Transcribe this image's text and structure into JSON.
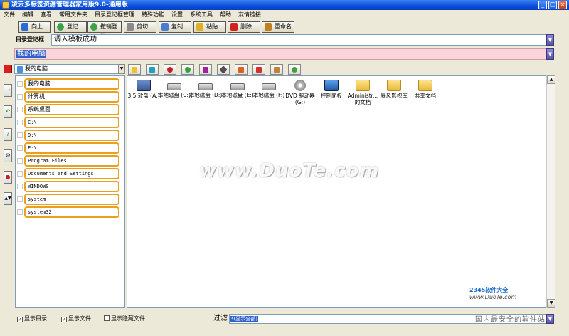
{
  "window": {
    "title": "凌云多标签资源管理器家用版9.0-通用版",
    "buttons": [
      "_",
      "□",
      "×"
    ]
  },
  "menu": [
    "文件",
    "编辑",
    "查看",
    "常用文件夹",
    "目录登记框管理",
    "特殊功能",
    "设置",
    "系统工具",
    "帮助",
    "友情链接"
  ],
  "toolbar": [
    {
      "label": "向上",
      "icon": "up-arrow-icon",
      "color": "#2a6bd1"
    },
    {
      "label": "登记",
      "icon": "register-icon",
      "color": "#3aa34a"
    },
    {
      "label": "撤销登记",
      "icon": "unregister-icon",
      "color": "#3aa34a"
    },
    {
      "label": "剪切",
      "icon": "scissors-icon",
      "color": "#8a8a8a"
    },
    {
      "label": "复制",
      "icon": "copy-icon",
      "color": "#4a7bd1"
    },
    {
      "label": "粘贴",
      "icon": "paste-icon",
      "color": "#e0b020"
    },
    {
      "label": "删除",
      "icon": "delete-icon",
      "color": "#d02020"
    },
    {
      "label": "重命名",
      "icon": "rename-icon",
      "color": "#c08020"
    }
  ],
  "register": {
    "label": "目录登记框",
    "message": "调入模板成功"
  },
  "path": {
    "value": "我的电脑"
  },
  "tree_combo": {
    "value": "我的电脑"
  },
  "tree": [
    "我的电脑",
    "计算机",
    "系统桌面",
    "C:\\",
    "D:\\",
    "E:\\",
    "Program Files",
    "Documents and Settings",
    "WINDOWS",
    "system",
    "system32"
  ],
  "file_toolbar_colors": [
    "#f0c030",
    "#20a0c0",
    "#c02020",
    "#30a040",
    "#a020a0",
    "#505050",
    "#e06020",
    "#d03030",
    "#c08040",
    "#40a040"
  ],
  "files": [
    {
      "label": "3.5 软盘 (A:)",
      "kind": "floppy"
    },
    {
      "label": "本地磁盘 (C:)",
      "kind": "drive"
    },
    {
      "label": "本地磁盘 (D:)",
      "kind": "drive"
    },
    {
      "label": "本地磁盘 (E:)",
      "kind": "drive"
    },
    {
      "label": "本地磁盘 (F:)",
      "kind": "drive"
    },
    {
      "label": "DVD 驱动器 (G:)",
      "kind": "dvd"
    },
    {
      "label": "控制面板",
      "kind": "ctrl"
    },
    {
      "label": "Administr... 的文档",
      "kind": "folder"
    },
    {
      "label": "暴风影视库",
      "kind": "folder"
    },
    {
      "label": "共享文档",
      "kind": "folder"
    }
  ],
  "bottom": {
    "show_dirs": {
      "label": "显示目录",
      "checked": true
    },
    "show_files": {
      "label": "显示文件",
      "checked": true
    },
    "show_hidden": {
      "label": "显示隐藏文件",
      "checked": false
    },
    "filter_label": "过滤",
    "filter_value": "*(显示全部)"
  },
  "watermark": "www.DuoTe.com",
  "brand": {
    "logo": "2345软件大全",
    "url": "www.DuoTe.com",
    "tagline": "国内最安全的软件站"
  }
}
